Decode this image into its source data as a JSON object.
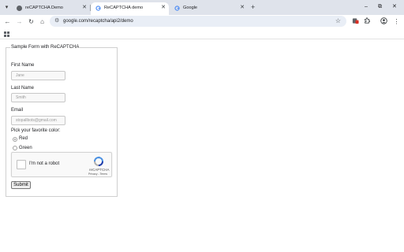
{
  "tabs": [
    {
      "title": "reCAPTCHA Demo",
      "active": false
    },
    {
      "title": "ReCAPTCHA demo",
      "active": true
    },
    {
      "title": "Google",
      "active": false
    }
  ],
  "toolbar": {
    "url": "google.com/recaptcha/api2/demo"
  },
  "colors": {
    "tabstrip": "#dfe3eb",
    "omnibox": "#e9eef6",
    "recaptcha_blue": "#4a90e2",
    "recaptcha_gray": "#b0b0b0"
  },
  "icons": [
    "tab-search-icon",
    "back-arrow-icon",
    "forward-arrow-icon",
    "reload-icon",
    "home-icon",
    "site-settings-icon",
    "bookmark-star-icon",
    "extension-icon",
    "puzzle-icon",
    "profile-icon",
    "menu-icon",
    "apps-grid-icon",
    "recaptcha-logo-icon"
  ],
  "form": {
    "legend": "Sample Form with ReCAPTCHA",
    "first_name": {
      "label": "First Name",
      "placeholder": "Jane"
    },
    "last_name": {
      "label": "Last Name",
      "placeholder": "Smith"
    },
    "email": {
      "label": "Email",
      "placeholder": "stopallbots@gmail.com"
    },
    "color_prompt": "Pick your favorite color:",
    "colors": [
      {
        "label": "Red",
        "checked": true
      },
      {
        "label": "Green",
        "checked": false
      }
    ],
    "recaptcha": {
      "label": "I'm not a robot",
      "brand": "reCAPTCHA",
      "terms": "Privacy - Terms"
    },
    "submit_label": "Submit"
  }
}
